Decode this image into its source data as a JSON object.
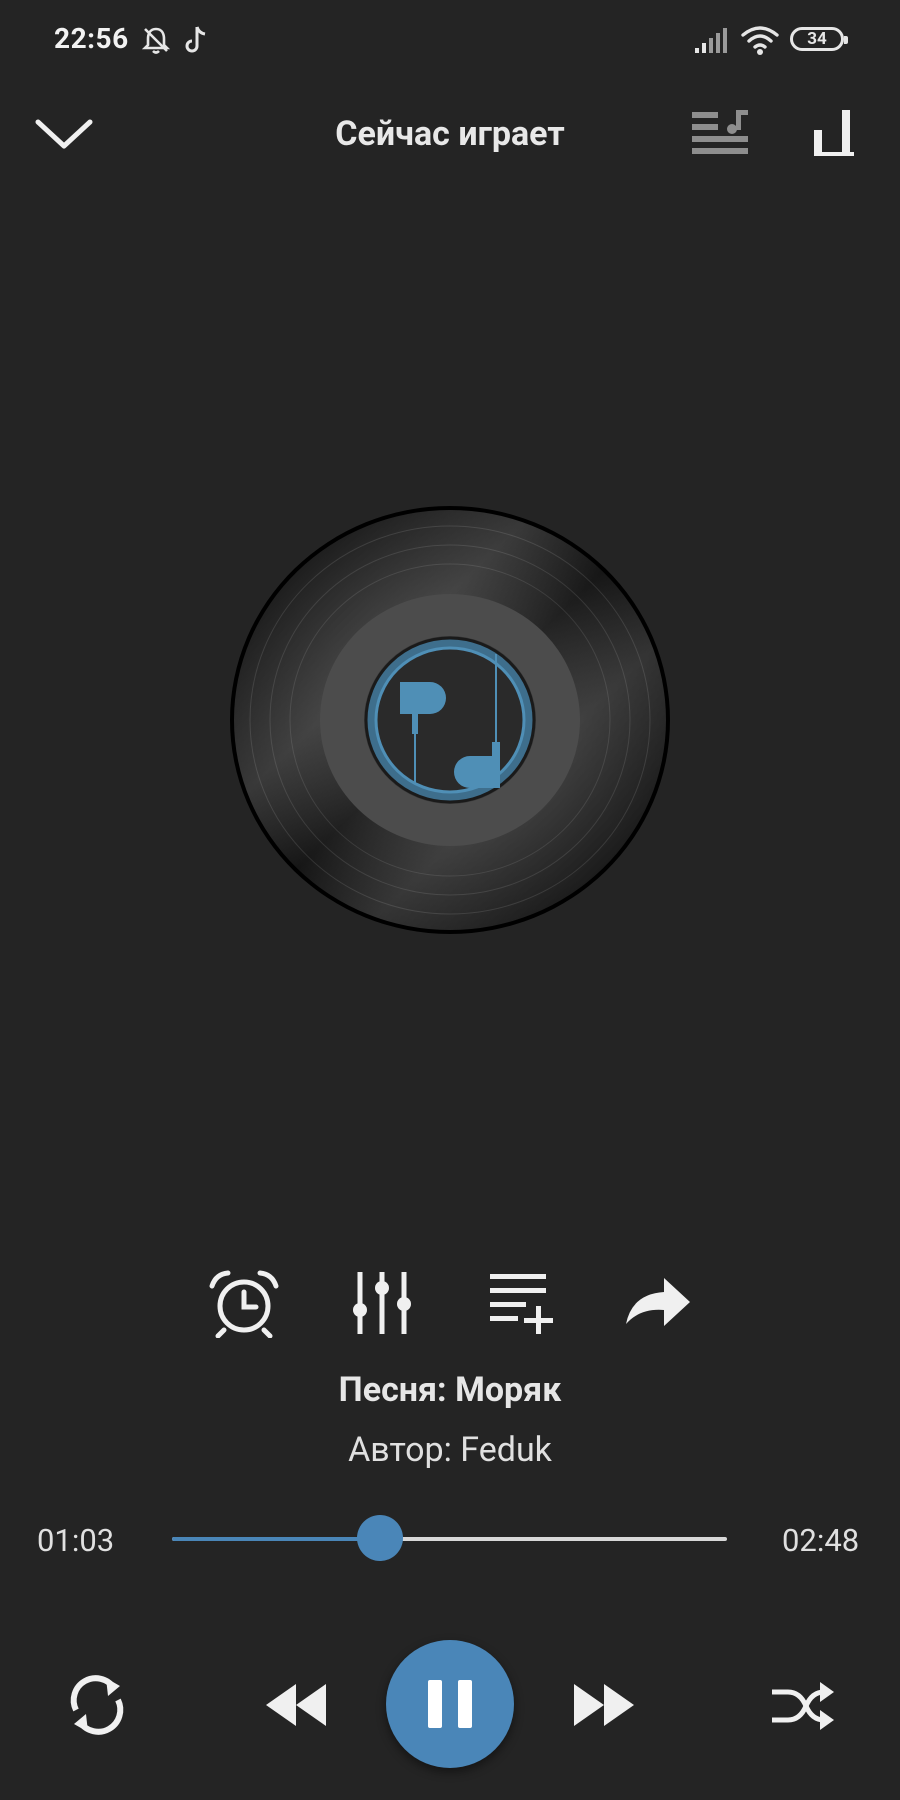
{
  "status_bar": {
    "time": "22:56",
    "battery": "34",
    "icons": [
      "muted-bell-icon",
      "tiktok-icon",
      "signal-icon",
      "wifi-icon",
      "battery-icon"
    ]
  },
  "toolbar": {
    "title": "Сейчас играет",
    "icons": [
      "chevron-down-icon",
      "playlist-icon",
      "equalizer-bars-icon"
    ]
  },
  "album_art": {
    "icon": "earphones-icon"
  },
  "actions": [
    "alarm-clock-icon",
    "equalizer-sliders-icon",
    "add-to-playlist-icon",
    "share-icon"
  ],
  "song": {
    "title": "Песня: Моряк",
    "author": "Автор: Feduk"
  },
  "progress": {
    "elapsed": "01:03",
    "total": "02:48",
    "fraction": 0.375
  },
  "controls": {
    "state": "playing",
    "icons": [
      "repeat-icon",
      "rewind-icon",
      "pause-icon",
      "fast-forward-icon",
      "shuffle-icon"
    ]
  },
  "colors": {
    "background": "#242424",
    "accent": "#4a86b8",
    "text": "#e6e6e6"
  }
}
